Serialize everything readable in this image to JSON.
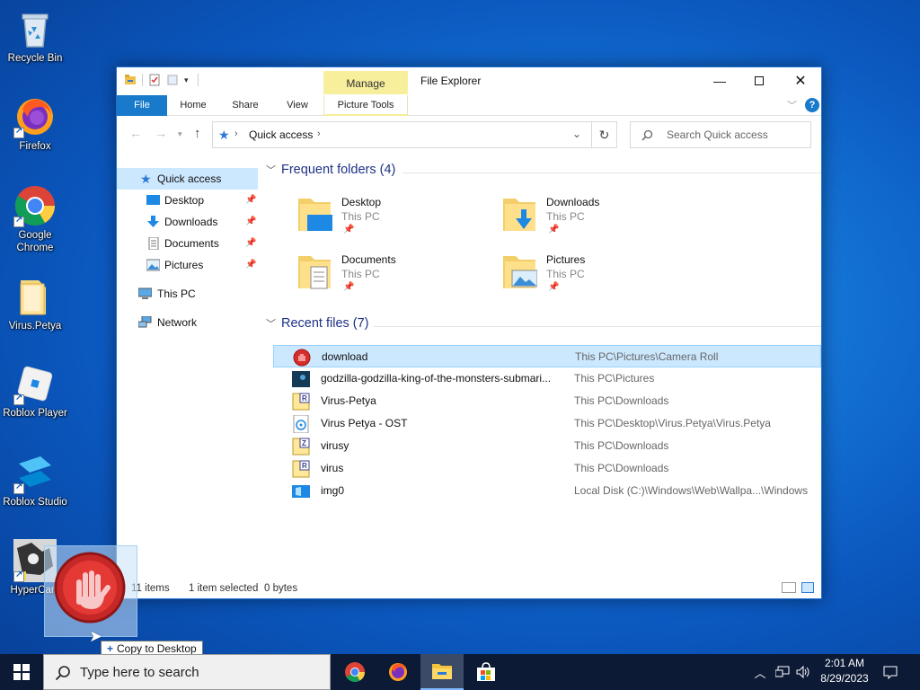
{
  "desktop": {
    "icons": [
      {
        "label": "Recycle Bin",
        "icon": "recycle-bin-icon"
      },
      {
        "label": "Firefox",
        "icon": "firefox-icon"
      },
      {
        "label": "Google Chrome",
        "icon": "chrome-icon"
      },
      {
        "label": "Virus.Petya",
        "icon": "folder-icon"
      },
      {
        "label": "Roblox Player",
        "icon": "roblox-icon"
      },
      {
        "label": "Roblox Studio",
        "icon": "roblox-studio-icon"
      },
      {
        "label": "HyperCam",
        "icon": "hypercam-icon"
      }
    ]
  },
  "drag": {
    "tooltip_label": "Copy to Desktop",
    "tooltip_symbol": "+"
  },
  "window": {
    "title": "File Explorer",
    "manage_tab": "Manage",
    "ribbon_tabs": [
      "File",
      "Home",
      "Share",
      "View",
      "Picture Tools"
    ],
    "address": {
      "path": "Quick access"
    },
    "search_placeholder": "Search Quick access",
    "nav": {
      "quick_access": "Quick access",
      "pinned": [
        "Desktop",
        "Downloads",
        "Documents",
        "Pictures"
      ],
      "this_pc": "This PC",
      "network": "Network"
    },
    "frequent": {
      "header": "Frequent folders (4)",
      "folders": [
        {
          "name": "Desktop",
          "location": "This PC"
        },
        {
          "name": "Downloads",
          "location": "This PC"
        },
        {
          "name": "Documents",
          "location": "This PC"
        },
        {
          "name": "Pictures",
          "location": "This PC"
        }
      ]
    },
    "recent": {
      "header": "Recent files (7)",
      "files": [
        {
          "name": "download",
          "location": "This PC\\Pictures\\Camera Roll",
          "icon": "stop-hand-icon"
        },
        {
          "name": "godzilla-godzilla-king-of-the-monsters-submari...",
          "location": "This PC\\Pictures",
          "icon": "image-file-icon"
        },
        {
          "name": "Virus-Petya",
          "location": "This PC\\Downloads",
          "icon": "rar-archive-icon"
        },
        {
          "name": "Virus Petya - OST",
          "location": "This PC\\Desktop\\Virus.Petya\\Virus.Petya",
          "icon": "audio-file-icon"
        },
        {
          "name": "virusy",
          "location": "This PC\\Downloads",
          "icon": "zip-archive-icon"
        },
        {
          "name": "virus",
          "location": "This PC\\Downloads",
          "icon": "rar-archive-icon"
        },
        {
          "name": "img0",
          "location": "Local Disk (C:)\\Windows\\Web\\Wallpa...\\Windows",
          "icon": "wallpaper-image-icon"
        }
      ]
    },
    "status": {
      "items": "11 items",
      "selected": "1 item selected",
      "size": "0 bytes"
    }
  },
  "taskbar": {
    "search_placeholder": "Type here to search",
    "time": "2:01 AM",
    "date": "8/29/2023",
    "apps": [
      "chrome-icon",
      "firefox-icon",
      "file-explorer-icon",
      "store-icon"
    ]
  },
  "colors": {
    "accent": "#1979ca",
    "selection": "#cce8ff",
    "manage_tab": "#f7ef9b",
    "group_header": "#1e3287"
  }
}
